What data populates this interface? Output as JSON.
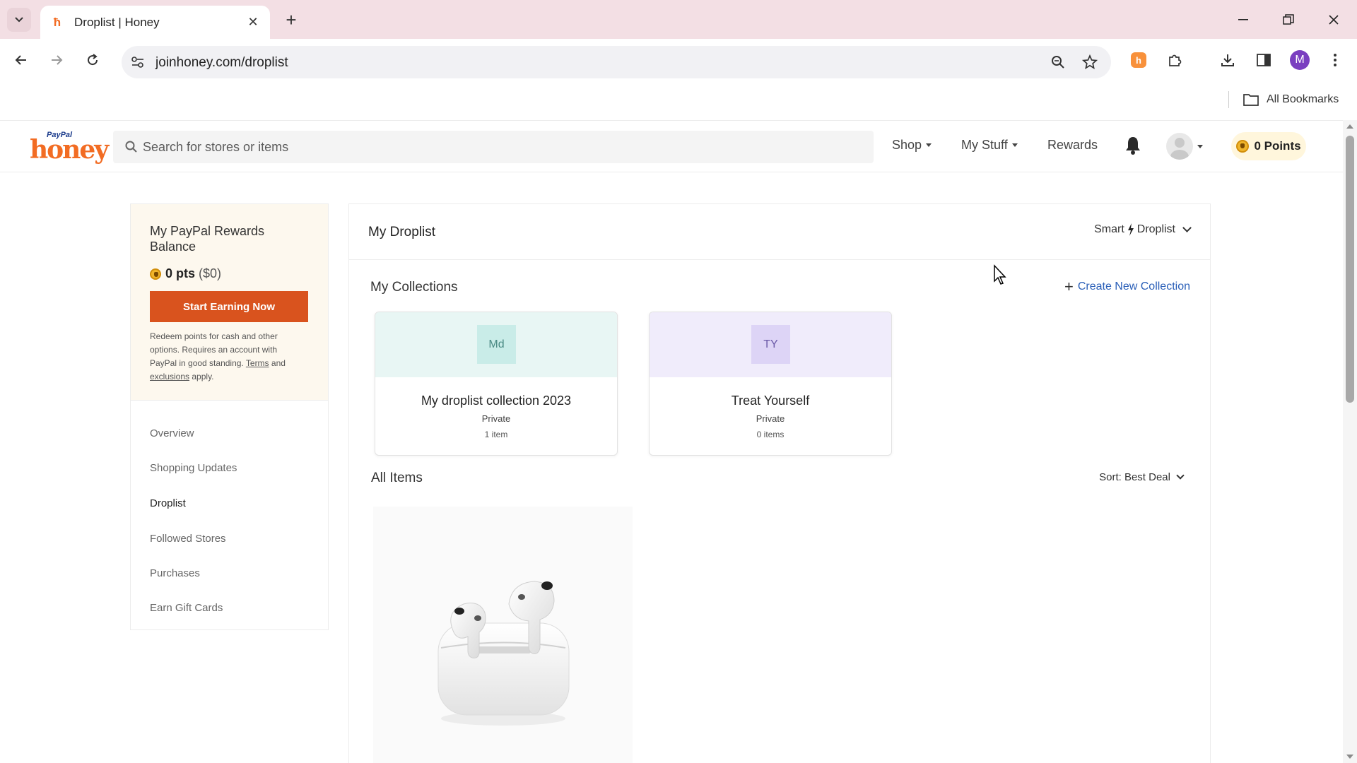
{
  "browser": {
    "tab_title": "Droplist | Honey",
    "url": "joinhoney.com/droplist",
    "bookmarks_label": "All Bookmarks",
    "profile_initial": "M",
    "extension_icon": "honey-extension-icon"
  },
  "header": {
    "search_placeholder": "Search for stores or items",
    "nav": {
      "shop": "Shop",
      "my_stuff": "My Stuff",
      "rewards": "Rewards"
    },
    "points_label": "0 Points",
    "logo": {
      "paypal": "PayPal",
      "honey": "honey"
    }
  },
  "sidebar": {
    "rewards_title": "My PayPal Rewards Balance",
    "points": "0 pts",
    "points_usd": "($0)",
    "cta": "Start Earning Now",
    "note_prefix": "Redeem points for cash and other options. Requires an account with PayPal in good standing.",
    "note_terms": "Terms",
    "note_and": "and",
    "note_exclusions": "exclusions",
    "note_suffix": "apply.",
    "items": [
      {
        "label": "Overview",
        "active": false
      },
      {
        "label": "Shopping Updates",
        "active": false
      },
      {
        "label": "Droplist",
        "active": true
      },
      {
        "label": "Followed Stores",
        "active": false
      },
      {
        "label": "Purchases",
        "active": false
      },
      {
        "label": "Earn Gift Cards",
        "active": false
      }
    ]
  },
  "main": {
    "title": "My Droplist",
    "smart_droplist": {
      "left": "Smart",
      "right": "Droplist"
    },
    "collections_title": "My Collections",
    "create_collection": "Create New Collection",
    "collections": [
      {
        "initials": "Md",
        "name": "My droplist collection 2023",
        "privacy": "Private",
        "count": "1 item",
        "banner_color": "#e8f6f4",
        "badge_color": "#c9ece8",
        "badge_text_color": "#4a8a84"
      },
      {
        "initials": "TY",
        "name": "Treat Yourself",
        "privacy": "Private",
        "count": "0 items",
        "banner_color": "#f0ecfb",
        "badge_color": "#ddd4f6",
        "badge_text_color": "#6b5aa8"
      }
    ],
    "all_items_title": "All Items",
    "sort_label": "Sort: Best Deal",
    "product_image": "airpods-pro-image"
  },
  "colors": {
    "accent_orange": "#d9531e",
    "link_blue": "#2a5fb8",
    "tabstrip_bg": "#f3dfe4"
  }
}
